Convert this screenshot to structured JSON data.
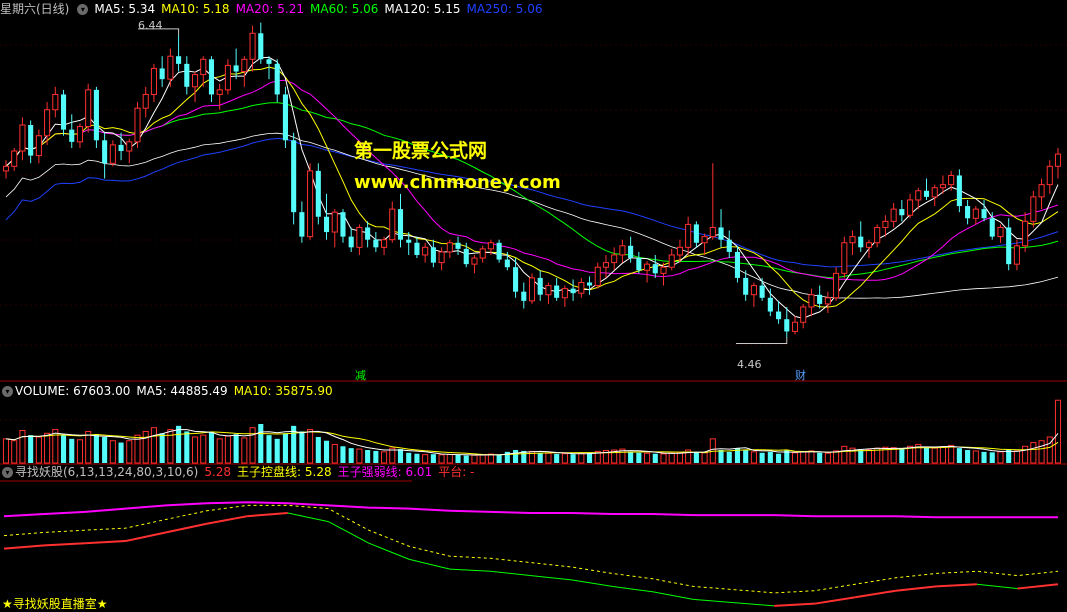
{
  "price_panel": {
    "title": "星期六(日线)",
    "indicators": [
      {
        "label": "MA5: 5.34",
        "color": "#ffffff"
      },
      {
        "label": "MA10: 5.18",
        "color": "#ffff00"
      },
      {
        "label": "MA20: 5.21",
        "color": "#ff00ff"
      },
      {
        "label": "MA60: 5.06",
        "color": "#00ff00"
      },
      {
        "label": "MA120: 5.15",
        "color": "#ffffff"
      },
      {
        "label": "MA250: 5.06",
        "color": "#2040ff"
      }
    ],
    "high_label": "6.44",
    "low_label": "4.46",
    "tag_jian": "减",
    "tag_cai": "财"
  },
  "watermark": {
    "line1": "第一股票公式网",
    "line2": "www.chnmoney.com"
  },
  "volume_panel": {
    "label_volume": "VOLUME: 67603.00",
    "label_ma5": "MA5: 44885.49",
    "label_ma10": "MA10: 35875.90"
  },
  "indicator_panel": {
    "name": "寻找妖股(6,13,13,24,80,3,10,6)",
    "value1": "5.28",
    "wang_kong": "王子控盘线: 5.28",
    "wang_qiang": "王子强弱线: 6.01",
    "pingtai": "平台: -"
  },
  "footer": {
    "label": "★寻找妖股直播室★"
  },
  "colors": {
    "up": "#ff3030",
    "down": "#54fcfc",
    "ma5": "#ffffff",
    "ma10": "#ffff00",
    "ma20": "#ff00ff",
    "ma60": "#00ff00",
    "ma120": "#ffffff",
    "ma250": "#2040ff",
    "panel_border": "#a00000"
  },
  "chart_data": {
    "type": "candlestick",
    "price_ylim": [
      4.3,
      6.55
    ],
    "candles": [
      [
        5.55,
        5.62,
        5.5,
        5.58
      ],
      [
        5.58,
        5.7,
        5.55,
        5.68
      ],
      [
        5.68,
        5.9,
        5.62,
        5.85
      ],
      [
        5.85,
        5.88,
        5.6,
        5.65
      ],
      [
        5.65,
        5.82,
        5.6,
        5.78
      ],
      [
        5.78,
        6.0,
        5.72,
        5.95
      ],
      [
        5.95,
        6.1,
        5.9,
        6.05
      ],
      [
        6.05,
        6.08,
        5.78,
        5.82
      ],
      [
        5.82,
        5.92,
        5.7,
        5.74
      ],
      [
        5.74,
        5.86,
        5.7,
        5.84
      ],
      [
        5.84,
        6.12,
        5.8,
        6.08
      ],
      [
        6.08,
        6.1,
        5.7,
        5.75
      ],
      [
        5.75,
        5.8,
        5.5,
        5.6
      ],
      [
        5.6,
        5.75,
        5.58,
        5.72
      ],
      [
        5.72,
        5.8,
        5.62,
        5.68
      ],
      [
        5.68,
        5.76,
        5.6,
        5.74
      ],
      [
        5.74,
        6.0,
        5.7,
        5.96
      ],
      [
        5.96,
        6.1,
        5.9,
        6.05
      ],
      [
        6.05,
        6.25,
        6.0,
        6.22
      ],
      [
        6.22,
        6.3,
        6.1,
        6.15
      ],
      [
        6.15,
        6.35,
        6.1,
        6.3
      ],
      [
        6.3,
        6.44,
        6.2,
        6.25
      ],
      [
        6.25,
        6.3,
        6.05,
        6.1
      ],
      [
        6.1,
        6.2,
        6.0,
        6.18
      ],
      [
        6.18,
        6.3,
        6.1,
        6.28
      ],
      [
        6.28,
        6.3,
        6.0,
        6.05
      ],
      [
        6.05,
        6.12,
        5.95,
        6.08
      ],
      [
        6.08,
        6.28,
        6.05,
        6.24
      ],
      [
        6.24,
        6.35,
        6.15,
        6.2
      ],
      [
        6.2,
        6.3,
        6.1,
        6.28
      ],
      [
        6.28,
        6.5,
        6.2,
        6.45
      ],
      [
        6.45,
        6.52,
        6.25,
        6.28
      ],
      [
        6.28,
        6.3,
        6.15,
        6.25
      ],
      [
        6.25,
        6.28,
        6.0,
        6.05
      ],
      [
        6.05,
        6.1,
        5.7,
        5.75
      ],
      [
        5.75,
        5.8,
        5.2,
        5.28
      ],
      [
        5.28,
        5.35,
        5.08,
        5.12
      ],
      [
        5.12,
        5.6,
        5.1,
        5.55
      ],
      [
        5.55,
        5.6,
        5.2,
        5.25
      ],
      [
        5.25,
        5.4,
        5.1,
        5.15
      ],
      [
        5.15,
        5.3,
        5.05,
        5.28
      ],
      [
        5.28,
        5.3,
        5.08,
        5.12
      ],
      [
        5.12,
        5.18,
        5.02,
        5.05
      ],
      [
        5.05,
        5.2,
        5.0,
        5.18
      ],
      [
        5.18,
        5.22,
        5.05,
        5.1
      ],
      [
        5.1,
        5.15,
        5.02,
        5.05
      ],
      [
        5.05,
        5.12,
        5.0,
        5.1
      ],
      [
        5.1,
        5.35,
        5.08,
        5.3
      ],
      [
        5.3,
        5.4,
        5.05,
        5.1
      ],
      [
        5.1,
        5.15,
        5.0,
        5.08
      ],
      [
        5.08,
        5.12,
        4.98,
        5.0
      ],
      [
        5.0,
        5.08,
        4.95,
        5.05
      ],
      [
        5.05,
        5.1,
        4.92,
        4.95
      ],
      [
        4.95,
        5.05,
        4.9,
        5.02
      ],
      [
        5.02,
        5.1,
        4.98,
        5.08
      ],
      [
        5.08,
        5.12,
        5.0,
        5.04
      ],
      [
        5.04,
        5.08,
        4.92,
        4.94
      ],
      [
        4.94,
        5.0,
        4.88,
        4.98
      ],
      [
        4.98,
        5.06,
        4.95,
        5.04
      ],
      [
        5.04,
        5.1,
        5.0,
        5.08
      ],
      [
        5.08,
        5.1,
        4.95,
        4.97
      ],
      [
        4.97,
        5.02,
        4.9,
        4.92
      ],
      [
        4.92,
        4.98,
        4.72,
        4.76
      ],
      [
        4.76,
        4.82,
        4.65,
        4.7
      ],
      [
        4.7,
        4.88,
        4.68,
        4.85
      ],
      [
        4.85,
        4.9,
        4.7,
        4.74
      ],
      [
        4.74,
        4.82,
        4.68,
        4.8
      ],
      [
        4.8,
        4.85,
        4.7,
        4.72
      ],
      [
        4.72,
        4.8,
        4.66,
        4.78
      ],
      [
        4.78,
        4.84,
        4.7,
        4.75
      ],
      [
        4.75,
        4.85,
        4.72,
        4.82
      ],
      [
        4.82,
        4.86,
        4.74,
        4.8
      ],
      [
        4.8,
        4.95,
        4.78,
        4.92
      ],
      [
        4.92,
        5.0,
        4.85,
        4.95
      ],
      [
        4.95,
        5.05,
        4.9,
        5.0
      ],
      [
        5.0,
        5.1,
        4.95,
        5.06
      ],
      [
        5.06,
        5.12,
        4.95,
        4.98
      ],
      [
        4.98,
        5.02,
        4.88,
        4.9
      ],
      [
        4.9,
        4.96,
        4.82,
        4.94
      ],
      [
        4.94,
        5.0,
        4.85,
        4.88
      ],
      [
        4.88,
        4.95,
        4.8,
        4.92
      ],
      [
        4.92,
        5.04,
        4.9,
        5.0
      ],
      [
        5.0,
        5.1,
        4.95,
        5.05
      ],
      [
        5.05,
        5.25,
        5.0,
        5.2
      ],
      [
        5.2,
        5.22,
        5.05,
        5.08
      ],
      [
        5.08,
        5.14,
        5.0,
        5.12
      ],
      [
        5.12,
        5.6,
        5.1,
        5.18
      ],
      [
        5.18,
        5.3,
        5.05,
        5.1
      ],
      [
        5.1,
        5.16,
        4.98,
        5.02
      ],
      [
        5.02,
        5.06,
        4.82,
        4.85
      ],
      [
        4.85,
        4.9,
        4.7,
        4.74
      ],
      [
        4.74,
        4.82,
        4.66,
        4.8
      ],
      [
        4.8,
        4.85,
        4.7,
        4.72
      ],
      [
        4.72,
        4.78,
        4.6,
        4.63
      ],
      [
        4.63,
        4.7,
        4.55,
        4.58
      ],
      [
        4.58,
        4.66,
        4.46,
        4.5
      ],
      [
        4.5,
        4.6,
        4.48,
        4.56
      ],
      [
        4.56,
        4.68,
        4.52,
        4.66
      ],
      [
        4.66,
        4.78,
        4.6,
        4.74
      ],
      [
        4.74,
        4.8,
        4.65,
        4.68
      ],
      [
        4.68,
        4.76,
        4.62,
        4.72
      ],
      [
        4.72,
        4.92,
        4.7,
        4.88
      ],
      [
        4.88,
        5.12,
        4.85,
        5.08
      ],
      [
        5.08,
        5.16,
        5.0,
        5.12
      ],
      [
        5.12,
        5.22,
        5.02,
        5.05
      ],
      [
        5.05,
        5.1,
        4.98,
        5.08
      ],
      [
        5.08,
        5.2,
        5.05,
        5.18
      ],
      [
        5.18,
        5.26,
        5.12,
        5.22
      ],
      [
        5.22,
        5.34,
        5.18,
        5.3
      ],
      [
        5.3,
        5.36,
        5.22,
        5.26
      ],
      [
        5.26,
        5.4,
        5.24,
        5.36
      ],
      [
        5.36,
        5.44,
        5.3,
        5.42
      ],
      [
        5.42,
        5.5,
        5.36,
        5.38
      ],
      [
        5.38,
        5.46,
        5.32,
        5.44
      ],
      [
        5.44,
        5.52,
        5.4,
        5.46
      ],
      [
        5.46,
        5.55,
        5.42,
        5.52
      ],
      [
        5.52,
        5.56,
        5.28,
        5.32
      ],
      [
        5.32,
        5.36,
        5.2,
        5.24
      ],
      [
        5.24,
        5.32,
        5.2,
        5.3
      ],
      [
        5.3,
        5.36,
        5.22,
        5.24
      ],
      [
        5.24,
        5.28,
        5.1,
        5.12
      ],
      [
        5.12,
        5.2,
        5.08,
        5.18
      ],
      [
        5.18,
        5.24,
        4.9,
        4.94
      ],
      [
        4.94,
        5.1,
        4.9,
        5.06
      ],
      [
        5.06,
        5.28,
        5.02,
        5.22
      ],
      [
        5.22,
        5.42,
        5.18,
        5.38
      ],
      [
        5.38,
        5.5,
        5.3,
        5.46
      ],
      [
        5.46,
        5.62,
        5.4,
        5.58
      ],
      [
        5.58,
        5.7,
        5.5,
        5.66
      ]
    ],
    "high": 6.44,
    "low": 4.46,
    "volume_ylim": [
      0,
      70000
    ],
    "volume": [
      26000,
      24000,
      35000,
      30000,
      28000,
      32000,
      36000,
      30000,
      26000,
      25000,
      34000,
      31000,
      28000,
      24000,
      22000,
      24000,
      30000,
      34000,
      38000,
      32000,
      36000,
      40000,
      34000,
      28000,
      30000,
      33000,
      26000,
      29000,
      31000,
      27000,
      38000,
      42000,
      30000,
      26000,
      32000,
      40000,
      34000,
      36000,
      28000,
      24000,
      20000,
      18000,
      16000,
      15000,
      14000,
      13000,
      12000,
      16000,
      15000,
      11000,
      10000,
      9000,
      9500,
      8800,
      9200,
      8600,
      8000,
      8400,
      9000,
      9600,
      8800,
      12000,
      14000,
      13000,
      12500,
      11000,
      10500,
      9800,
      10000,
      9500,
      10200,
      11000,
      12500,
      13500,
      14000,
      15000,
      12000,
      11000,
      10500,
      10000,
      9800,
      10500,
      11500,
      14000,
      12000,
      11000,
      26000,
      14000,
      12000,
      16000,
      14000,
      12000,
      11000,
      12000,
      10000,
      14000,
      11000,
      12000,
      13000,
      11000,
      10500,
      13000,
      18000,
      16000,
      15000,
      14000,
      16000,
      17000,
      16500,
      15000,
      18000,
      20000,
      17000,
      16000,
      17500,
      19000,
      16000,
      14000,
      13000,
      12000,
      11500,
      12000,
      14000,
      13000,
      18000,
      22000,
      24000,
      28000,
      67603
    ],
    "indicator_ylim": [
      0,
      1
    ],
    "pink_line": [
      0.85,
      0.87,
      0.89,
      0.92,
      0.95,
      0.97,
      0.98,
      0.97,
      0.95,
      0.93,
      0.92,
      0.9,
      0.89,
      0.88,
      0.88,
      0.87,
      0.87,
      0.86,
      0.86,
      0.86,
      0.85,
      0.85,
      0.85,
      0.84,
      0.84,
      0.84,
      0.84
    ],
    "lower_line": [
      0.55,
      0.58,
      0.6,
      0.62,
      0.7,
      0.78,
      0.85,
      0.88,
      0.8,
      0.6,
      0.45,
      0.36,
      0.34,
      0.3,
      0.26,
      0.2,
      0.15,
      0.08,
      0.05,
      0.02,
      0.04,
      0.1,
      0.16,
      0.2,
      0.22,
      0.18,
      0.22
    ]
  }
}
